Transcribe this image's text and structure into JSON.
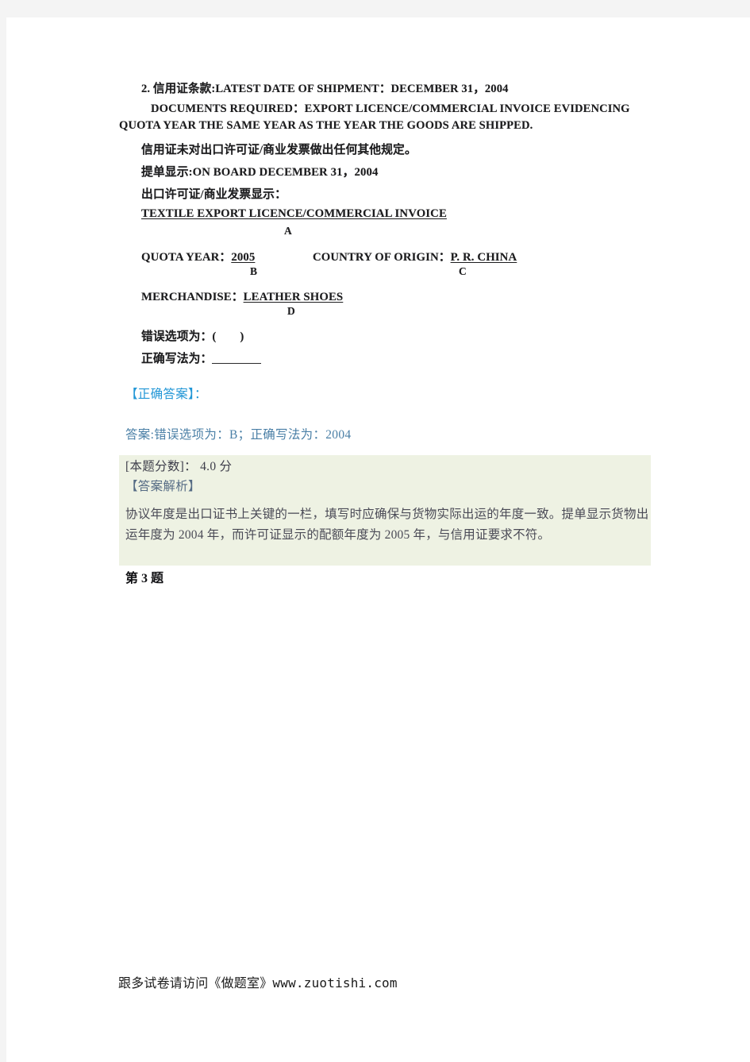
{
  "document": {
    "question": {
      "number_label": "2.",
      "lines": [
        "2. 信用证条款:LATEST DATE OF SHIPMENT：DECEMBER 31，2004",
        "DOCUMENTS REQUIRED：EXPORT LICENCE/COMMERCIAL INVOICE EVIDENCING",
        "QUOTA YEAR THE SAME YEAR AS THE YEAR THE GOODS ARE SHIPPED.",
        "信用证未对出口许可证/商业发票做出任何其他规定。",
        "提单显示:ON BOARD DECEMBER 31，2004",
        "出口许可证/商业发票显示：",
        "TEXTILE EXPORT LICENCE/COMMERCIAL INVOICE",
        "QUOTA YEAR：2005",
        "COUNTRY OF ORIGIN：P. R. CHINA",
        "MERCHANDISE：LEATHER SHOES",
        "错误选项为：(",
        "正确写法为："
      ],
      "line1_prefix": "2. 信用证条款:",
      "line1_value": "LATEST DATE OF SHIPMENT：DECEMBER 31，2004",
      "line2": "DOCUMENTS REQUIRED：EXPORT LICENCE/COMMERCIAL INVOICE EVIDENCING",
      "line3": "QUOTA YEAR THE SAME YEAR AS THE YEAR THE GOODS ARE SHIPPED.",
      "line4": "信用证未对出口许可证/商业发票做出任何其他规定。",
      "line5": "提单显示:ON BOARD DECEMBER 31，2004",
      "line6": "出口许可证/商业发票显示：",
      "doc_title": "TEXTILE EXPORT LICENCE/COMMERCIAL INVOICE",
      "quota_year_label": "QUOTA YEAR：",
      "quota_year_value": "2005",
      "country_label": "COUNTRY OF ORIGIN：",
      "country_value": "P. R. CHINA",
      "merchandise_label": "MERCHANDISE：",
      "merchandise_value": "LEATHER SHOES",
      "wrong_option_prompt_open": "错误选项为：(",
      "wrong_option_prompt_close": ")",
      "correct_form_prompt": "正确写法为：",
      "option_markers": [
        "A",
        "B",
        "C",
        "D"
      ]
    },
    "answer": {
      "heading": "【正确答案】：",
      "answer_text": "答案:错误选项为：B；正确写法为：2004",
      "score_line": "[本题分数]： 4.0 分",
      "analysis_heading": "【答案解析】",
      "analysis_body": "协议年度是出口证书上关键的一栏，填写时应确保与货物实际出运的年度一致。提单显示货物出运年度为 2004 年，而许可证显示的配额年度为 2005 年，与信用证要求不符。"
    },
    "next_question_label": "第 3 题",
    "footer_text": "跟多试卷请访问《做题室》www.zuotishi.com"
  },
  "colors": {
    "page_background": "#f4f4f4",
    "sheet": "#ffffff",
    "answer_heading": "#2196d6",
    "answer_text": "#4a7fa6",
    "analysis_block_background": "#eef2e3",
    "analysis_text": "#4a4a56",
    "scan_text": "#1c1c1e"
  }
}
